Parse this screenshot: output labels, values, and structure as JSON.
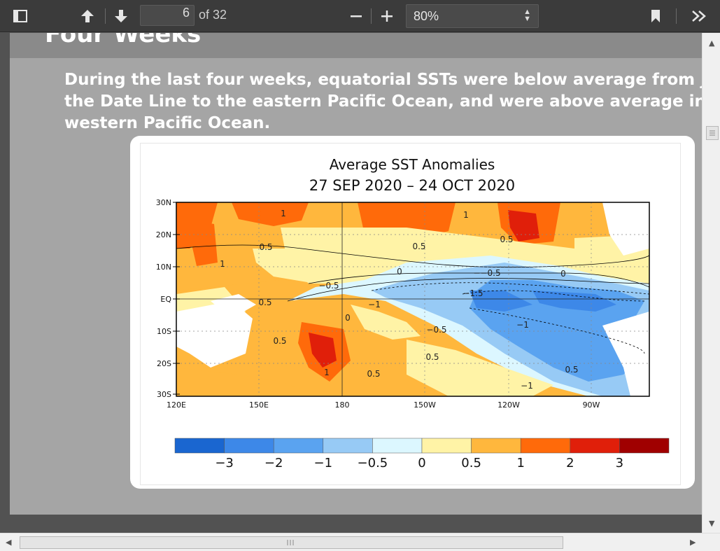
{
  "toolbar": {
    "page_number": "6",
    "page_total": "of 32",
    "zoom": "80%"
  },
  "slide": {
    "title": "Four Weeks",
    "paragraph_lines": [
      "During the last four weeks, equatorial SSTs were below average from just we",
      "the Date Line to the eastern Pacific Ocean, and were above average in the f",
      "western Pacific Ocean."
    ]
  },
  "figure": {
    "title": "Average SST Anomalies",
    "date_range": "27 SEP 2020 – 24 OCT 2020",
    "lat_labels": [
      "30N",
      "20N",
      "10N",
      "EQ",
      "10S",
      "20S",
      "30S"
    ],
    "lon_labels": [
      "120E",
      "150E",
      "180",
      "150W",
      "120W",
      "90W"
    ],
    "contour_labels": [
      "1",
      "0.5",
      "1",
      "1",
      "0.5",
      "0.5",
      "−0.5",
      "0.5",
      "0",
      "−−0.5",
      "0",
      "−1.5",
      "−1",
      "0",
      "−0.5",
      "−1",
      "0.5",
      "0.5",
      "1",
      "0.5",
      "0.5",
      "−1"
    ],
    "colorbar_labels": [
      "−3",
      "−2",
      "−1",
      "−0.5",
      "0",
      "0.5",
      "1",
      "2",
      "3"
    ],
    "colorbar_colors": [
      "#1a66d0",
      "#3d88e8",
      "#5aa3f0",
      "#97caf5",
      "#dcf7ff",
      "#fff3a6",
      "#ffb73d",
      "#ff6a0a",
      "#e01f0a",
      "#a00000"
    ]
  }
}
